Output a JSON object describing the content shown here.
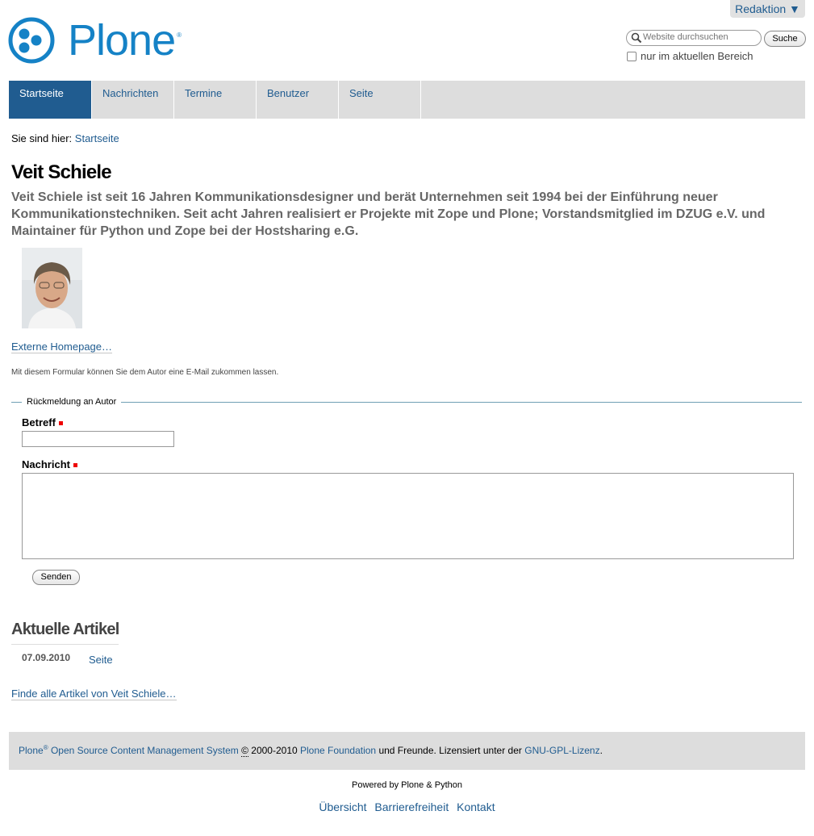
{
  "header": {
    "logo_text": "Plone",
    "logo_reg": "®",
    "redaktion_label": "Redaktion ▼",
    "search_placeholder": "Website durchsuchen",
    "search_button": "Suche",
    "scope_label": "nur im aktuellen Bereich"
  },
  "nav": {
    "tabs": [
      {
        "label": "Startseite",
        "active": true
      },
      {
        "label": "Nachrichten"
      },
      {
        "label": "Termine"
      },
      {
        "label": "Benutzer"
      },
      {
        "label": "Seite"
      }
    ]
  },
  "breadcrumb": {
    "prefix": "Sie sind hier:",
    "current": "Startseite"
  },
  "content": {
    "title": "Veit Schiele",
    "description": "Veit Schiele ist seit 16 Jahren Kommunikationsdesigner und berät Unternehmen seit 1994 bei der Einführung neuer Kommunikationstechniken. Seit acht Jahren realisiert er Projekte mit Zope und Plone; Vorstandsmitglied im DZUG e.V. und Maintainer für Python und Zope bei der Hostsharing e.G.",
    "homepage_link": "Externe Homepage…",
    "form_help": "Mit diesem Formular können Sie dem Autor eine E-Mail zukommen lassen."
  },
  "form": {
    "legend": "Rückmeldung an Autor",
    "subject_label": "Betreff",
    "message_label": "Nachricht",
    "submit_label": "Senden"
  },
  "articles": {
    "heading": "Aktuelle Artikel",
    "items": [
      {
        "date": "07.09.2010",
        "title": "Seite"
      }
    ],
    "all_link": "Finde alle Artikel von Veit Schiele…"
  },
  "footer": {
    "plone": "Plone",
    "reg": "®",
    "cms": "Open Source Content Management System",
    "copy_symbol": "©",
    "years": "2000-2010",
    "foundation": "Plone Foundation",
    "friends_text": "und Freunde. Lizensiert unter der",
    "license": "GNU-GPL-Lizenz",
    "period": ".",
    "powered": "Powered by Plone & Python",
    "actions": [
      "Übersicht",
      "Barrierefreiheit",
      "Kontakt"
    ]
  },
  "colors": {
    "link": "#205c90",
    "brand": "#1582c6",
    "nav_bg": "#dddddd",
    "required": "#ee0000"
  }
}
